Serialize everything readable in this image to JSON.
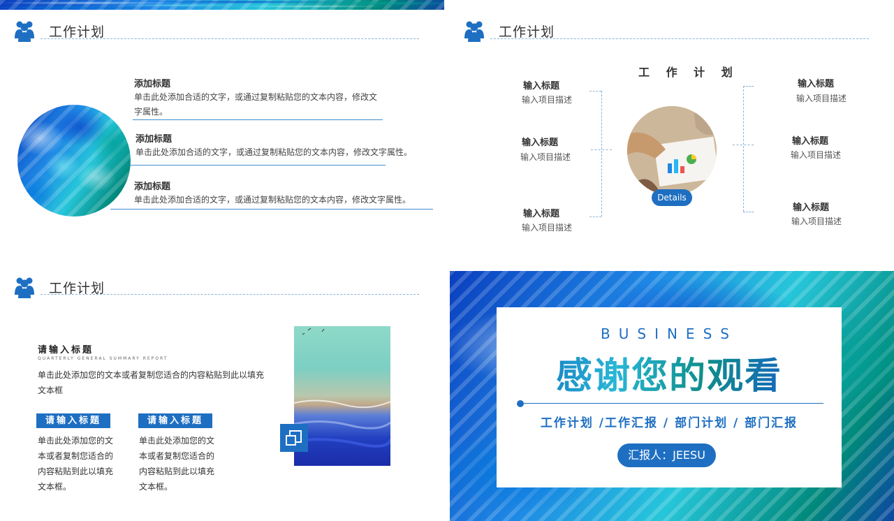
{
  "slide1": {
    "header": "工作计划",
    "items": [
      {
        "title": "添加标题",
        "desc_line1": "单击此处添加合适的文字，或通过复制粘贴您的文本内容，修改文",
        "desc_line2": "字属性。"
      },
      {
        "title": "添加标题",
        "desc_line1": "单击此处添加合适的文字，或通过复制粘贴您的文本内容，修改文字属性。"
      },
      {
        "title": "添加标题",
        "desc_line1": "单击此处添加合适的文字，或通过复制粘贴您的文本内容，修改文字属性。"
      }
    ]
  },
  "slide2": {
    "header": "工作计划",
    "center_title": "工 作 计 划",
    "details_label": "Details",
    "left": [
      {
        "title": "输入标题",
        "desc": "输入项目描述"
      },
      {
        "title": "输入标题",
        "desc": "输入项目描述"
      },
      {
        "title": "输入标题",
        "desc": "输入项目描述"
      }
    ],
    "right": [
      {
        "title": "输入标题",
        "desc": "输入项目描述"
      },
      {
        "title": "输入标题",
        "desc": "输入项目描述"
      },
      {
        "title": "输入标题",
        "desc": "输入项目描述"
      }
    ]
  },
  "slide3": {
    "header": "工作计划",
    "main_title": "请输入标题",
    "subtitle": "QUARTERLY GENERAL SUMMARY REPORT",
    "main_text": "单击此处添加您的文本或者复制您适合的内容粘贴到此以填充文本框",
    "blocks": [
      {
        "badge": "请输入标题",
        "text": "单击此处添加您的文本或者复制您适合的内容粘贴到此以填充文本框。"
      },
      {
        "badge": "请输入标题",
        "text": "单击此处添加您的文本或者复制您适合的内容粘贴到此以填充文本框。"
      }
    ]
  },
  "slide4": {
    "eyebrow": "BUSINESS",
    "title": "感谢您的观看",
    "subtitle": "工作计划 /工作汇报 / 部门计划 / 部门汇报",
    "reporter": "汇报人：JEESU"
  },
  "colors": {
    "accent": "#1e6fc2",
    "line": "#8ab4d8"
  },
  "icons": {
    "header": "people-icon",
    "sea_badge": "copy-icon"
  }
}
